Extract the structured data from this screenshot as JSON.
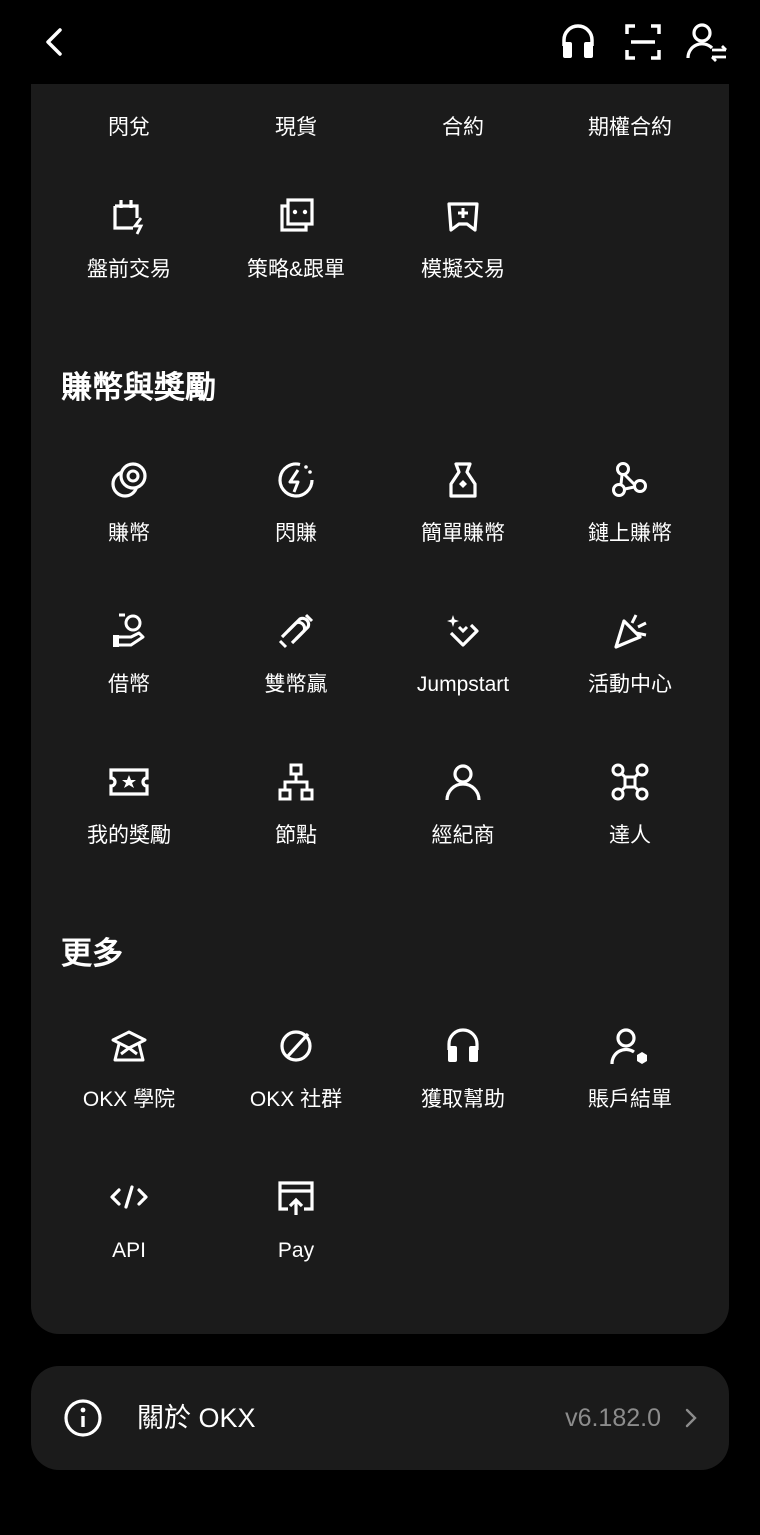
{
  "trade_row_top": [
    "閃兌",
    "現貨",
    "合約",
    "期權合約"
  ],
  "trade_items": [
    {
      "label": "盤前交易",
      "icon": "calendar-bolt-icon"
    },
    {
      "label": "策略&跟單",
      "icon": "bot-icon"
    },
    {
      "label": "模擬交易",
      "icon": "gamepad-icon"
    }
  ],
  "earn": {
    "title": "賺幣與獎勵",
    "items": [
      {
        "label": "賺幣",
        "icon": "coins-icon"
      },
      {
        "label": "閃賺",
        "icon": "flash-earn-icon"
      },
      {
        "label": "簡單賺幣",
        "icon": "money-bag-icon"
      },
      {
        "label": "鏈上賺幣",
        "icon": "onchain-nodes-icon"
      },
      {
        "label": "借幣",
        "icon": "loan-hand-icon"
      },
      {
        "label": "雙幣贏",
        "icon": "dual-currency-icon"
      },
      {
        "label": "Jumpstart",
        "icon": "sparkle-diamond-icon"
      },
      {
        "label": "活動中心",
        "icon": "party-popper-icon"
      },
      {
        "label": "我的獎勵",
        "icon": "ticket-star-icon"
      },
      {
        "label": "節點",
        "icon": "network-node-icon"
      },
      {
        "label": "經紀商",
        "icon": "person-icon"
      },
      {
        "label": "達人",
        "icon": "molecule-icon"
      }
    ]
  },
  "more": {
    "title": "更多",
    "items": [
      {
        "label": "OKX 學院",
        "icon": "graduation-cap-icon"
      },
      {
        "label": "OKX 社群",
        "icon": "planet-icon"
      },
      {
        "label": "獲取幫助",
        "icon": "headset-icon"
      },
      {
        "label": "賬戶結單",
        "icon": "account-settings-icon"
      },
      {
        "label": "API",
        "icon": "code-icon"
      },
      {
        "label": "Pay",
        "icon": "pay-card-icon"
      }
    ]
  },
  "about": {
    "title": "關於 OKX",
    "version": "v6.182.0"
  },
  "colors": {
    "background": "#000000",
    "panel": "#1b1b1b",
    "text": "#ffffff",
    "muted": "#8c8c8c"
  }
}
